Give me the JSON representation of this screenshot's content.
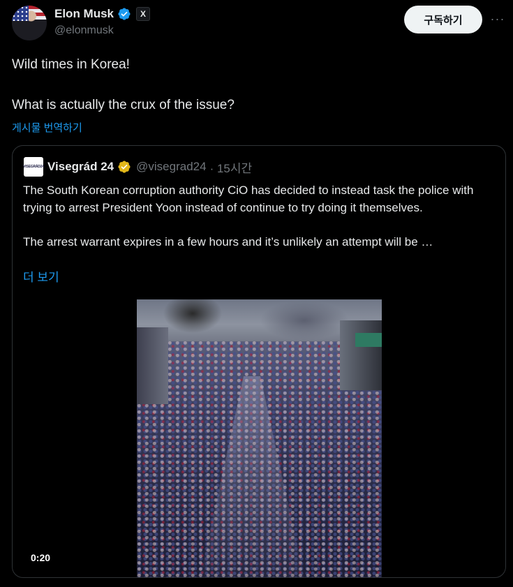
{
  "author": {
    "name": "Elon Musk",
    "handle": "@elonmusk",
    "badge": "X",
    "verified_color": "#1d9bf0"
  },
  "actions": {
    "subscribe_label": "구독하기",
    "more_label": "···"
  },
  "tweet": {
    "lines": [
      "Wild times in Korea!",
      "What is actually the crux of the issue?"
    ],
    "translate_label": "게시물 번역하기"
  },
  "quoted": {
    "logo_text": "VISEGRÁD24",
    "name": "Visegrád 24",
    "handle": "@visegrad24",
    "time": "· 15시간",
    "verified_color": "#e2b719",
    "paragraphs": [
      "The South Korean corruption authority CiO has decided to instead task the police with trying to arrest President Yoon instead of continue to try doing it themselves.",
      "The arrest warrant expires in a few hours and it’s unlikely an attempt will be …"
    ],
    "show_more_label": "더 보기",
    "video": {
      "duration": "0:20"
    }
  },
  "colors": {
    "background": "#000000",
    "text": "#e7e9ea",
    "muted": "#71767b",
    "link": "#1d9bf0",
    "border": "#2f3336"
  }
}
